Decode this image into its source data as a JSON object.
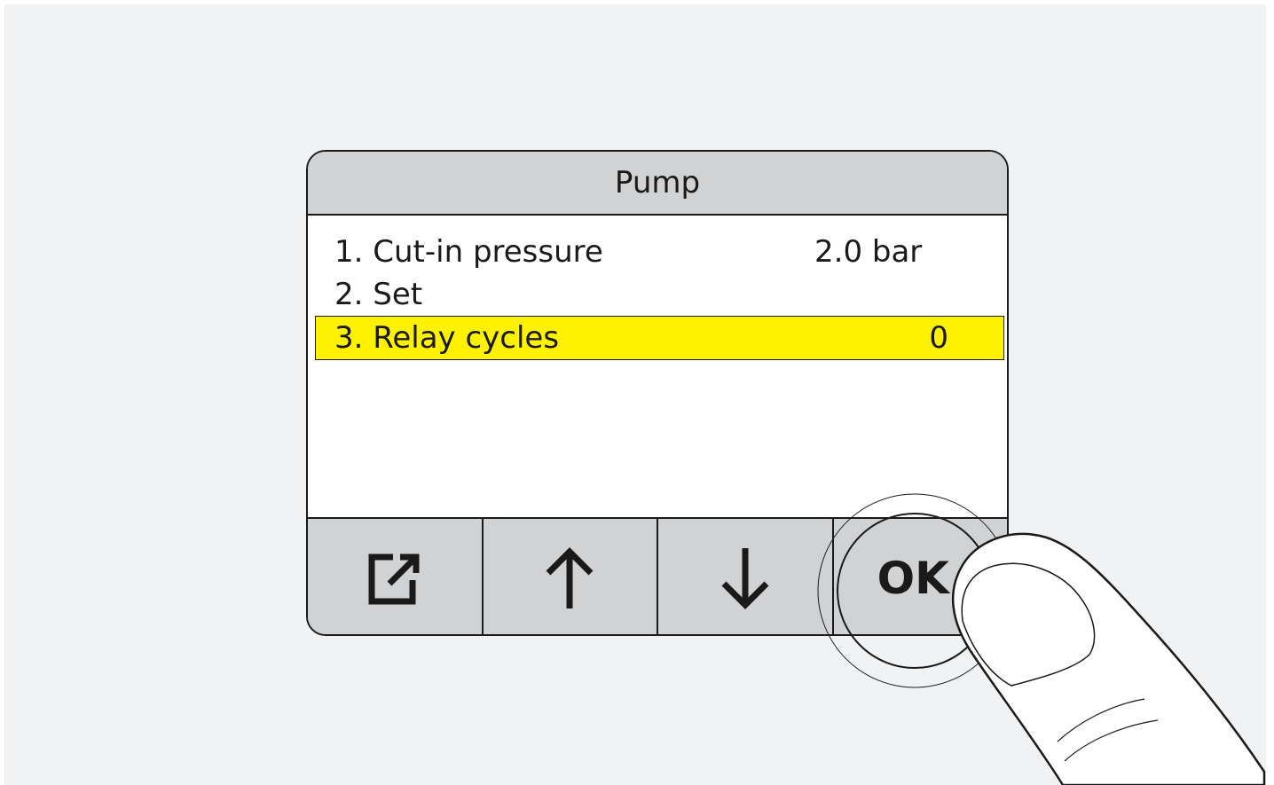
{
  "panel": {
    "title": "Pump"
  },
  "menu": {
    "items": [
      {
        "label": "1. Cut-in pressure",
        "value": "2.0 bar"
      },
      {
        "label": "2. Set",
        "value": ""
      },
      {
        "label": "3. Relay cycles",
        "value": "0"
      }
    ],
    "selected_index": 2
  },
  "toolbar": {
    "buttons": [
      {
        "icon": "exit-icon"
      },
      {
        "icon": "arrow-up-icon"
      },
      {
        "icon": "arrow-down-icon"
      },
      {
        "label": "OK"
      }
    ]
  },
  "colors": {
    "header_bg": "#d1d2d4",
    "selection": "#fff200",
    "background": "#f1f2f4"
  }
}
